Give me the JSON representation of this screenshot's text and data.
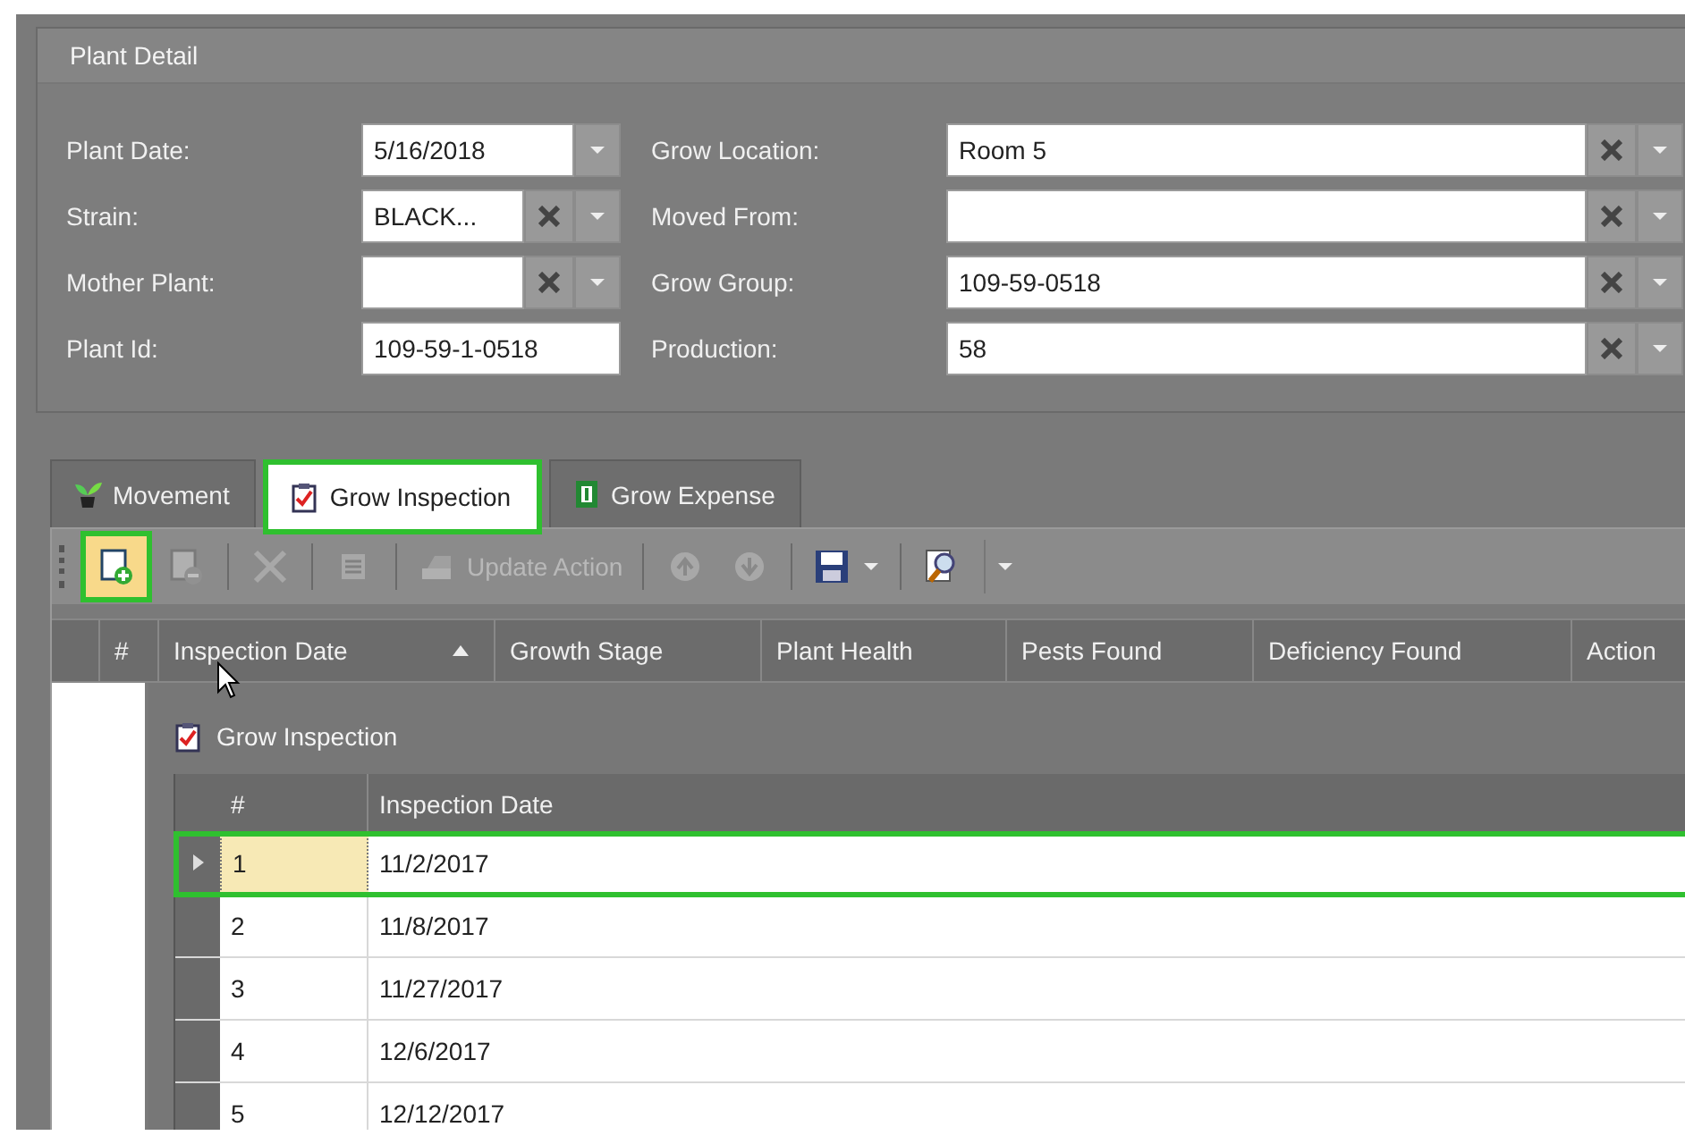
{
  "plant_detail": {
    "title": "Plant Detail",
    "fields": [
      {
        "label": "Plant Date:",
        "value": "5/16/2018",
        "kind": "date"
      },
      {
        "label": "Grow Location:",
        "value": "Room 5",
        "kind": "lookup"
      },
      {
        "label": "Strain:",
        "value": "BLACK...",
        "kind": "lookup"
      },
      {
        "label": "Moved From:",
        "kind": "lookup"
      },
      {
        "label": "Mother Plant:",
        "kind": "lookup"
      },
      {
        "label": "Grow Group:",
        "value": "109-59-0518",
        "kind": "lookup"
      },
      {
        "label": "Plant Id:",
        "value": "109-59-1-0518",
        "kind": "text"
      },
      {
        "label": "Production:",
        "value": "58",
        "kind": "lookup"
      }
    ]
  },
  "tabs": [
    {
      "label": "Movement",
      "selected": false
    },
    {
      "label": "Grow Inspection",
      "selected": true
    },
    {
      "label": "Grow Expense",
      "selected": false
    }
  ],
  "toolbar": [
    {
      "kind": "new",
      "disabled": false,
      "highlighted": true
    },
    {
      "kind": "delete",
      "disabled": true,
      "highlighted": false
    },
    {
      "kind": "separator"
    },
    {
      "kind": "remove",
      "disabled": true,
      "highlighted": false
    },
    {
      "kind": "separator"
    },
    {
      "kind": "edit",
      "disabled": true,
      "highlighted": false
    },
    {
      "kind": "separator"
    },
    {
      "kind": "update",
      "label": "Update Action",
      "disabled": true,
      "highlighted": false
    },
    {
      "kind": "separator"
    },
    {
      "kind": "move-up",
      "disabled": true,
      "highlighted": false
    },
    {
      "kind": "move-down",
      "disabled": true,
      "highlighted": false
    },
    {
      "kind": "separator"
    },
    {
      "kind": "save",
      "disabled": false,
      "highlighted": false
    },
    {
      "kind": "separator"
    },
    {
      "kind": "find",
      "disabled": false,
      "highlighted": false
    }
  ],
  "grid": {
    "columns": [
      {
        "label": "#",
        "sorted": false
      },
      {
        "label": "Inspection Date",
        "sorted": true
      },
      {
        "label": "Growth Stage",
        "sorted": false
      },
      {
        "label": "Plant Health",
        "sorted": false
      },
      {
        "label": "Pests Found",
        "sorted": false
      },
      {
        "label": "Deficiency Found",
        "sorted": false
      },
      {
        "label": "Action",
        "sorted": false
      }
    ],
    "detail": {
      "title": "Grow Inspection",
      "columns": [
        "#",
        "Inspection Date"
      ],
      "rows": [
        {
          "cells": [
            "1",
            "11/2/2017"
          ],
          "selected": true
        },
        {
          "cells": [
            "2",
            "11/8/2017"
          ],
          "selected": false
        },
        {
          "cells": [
            "3",
            "11/27/2017"
          ],
          "selected": false
        },
        {
          "cells": [
            "4",
            "12/6/2017"
          ],
          "selected": false
        },
        {
          "cells": [
            "5",
            "12/12/2017"
          ],
          "selected": false
        }
      ]
    }
  }
}
